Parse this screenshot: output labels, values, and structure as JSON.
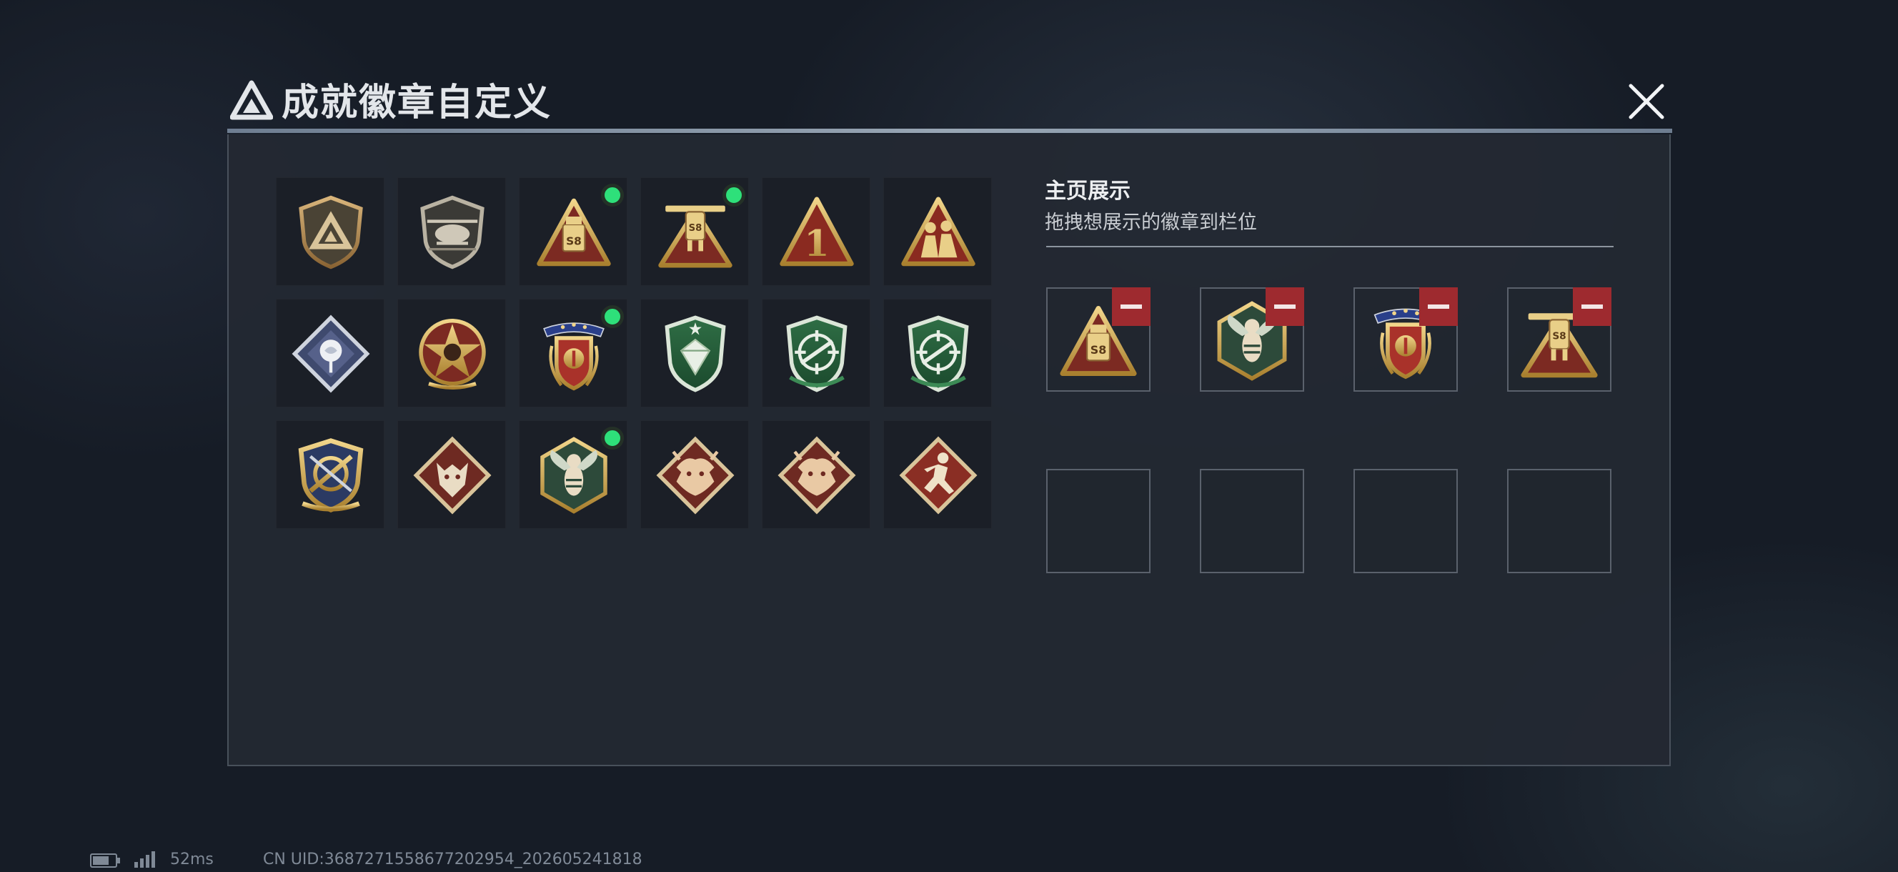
{
  "dialog": {
    "title": "成就徽章自定义",
    "close_icon": "close-icon"
  },
  "inventory": {
    "badges": [
      {
        "icon": "tri-emblem-shield-badge-icon",
        "new": false
      },
      {
        "icon": "helicopter-shield-badge-icon",
        "new": false
      },
      {
        "icon": "s8-triangle-badge-icon",
        "new": true
      },
      {
        "icon": "s8-robot-triangle-badge-icon",
        "new": true
      },
      {
        "icon": "number-one-triangle-badge-icon",
        "new": false
      },
      {
        "icon": "soldiers-triangle-badge-icon",
        "new": false
      },
      {
        "icon": "rose-diamond-badge-icon",
        "new": false
      },
      {
        "icon": "star-skull-medal-badge-icon",
        "new": false
      },
      {
        "icon": "laurel-ribbon-medal-badge-icon",
        "new": true
      },
      {
        "icon": "gem-green-shield-badge-icon",
        "new": false
      },
      {
        "icon": "crosshair-green-shield-badge-icon",
        "new": false
      },
      {
        "icon": "crosshair-green-shield-alt-badge-icon",
        "new": false
      },
      {
        "icon": "crossed-rifles-gold-shield-badge-icon",
        "new": false
      },
      {
        "icon": "wolf-diamond-badge-icon",
        "new": false
      },
      {
        "icon": "wasp-hexagon-badge-icon",
        "new": true
      },
      {
        "icon": "dragon-diamond-badge-icon",
        "new": false
      },
      {
        "icon": "dragon-diamond-alt-badge-icon",
        "new": false
      },
      {
        "icon": "runner-diamond-badge-icon",
        "new": false
      }
    ]
  },
  "showcase": {
    "title": "主页展示",
    "subtitle": "拖拽想展示的徽章到栏位",
    "slots": [
      {
        "icon": "s8-triangle-badge-icon",
        "filled": true
      },
      {
        "icon": "wasp-hexagon-badge-icon",
        "filled": true
      },
      {
        "icon": "laurel-ribbon-medal-badge-icon",
        "filled": true
      },
      {
        "icon": "s8-robot-triangle-badge-icon",
        "filled": true
      },
      {
        "filled": false
      },
      {
        "filled": false
      },
      {
        "filled": false
      },
      {
        "filled": false
      }
    ],
    "remove_icon": "minus-icon"
  },
  "status_bar": {
    "ping": "52ms",
    "uid": "CN UID:3687271558677202954_202605241818"
  },
  "colors": {
    "new_indicator": "#2ee07a",
    "remove_button": "#9e2a2f",
    "panel_bg": "#242933"
  }
}
